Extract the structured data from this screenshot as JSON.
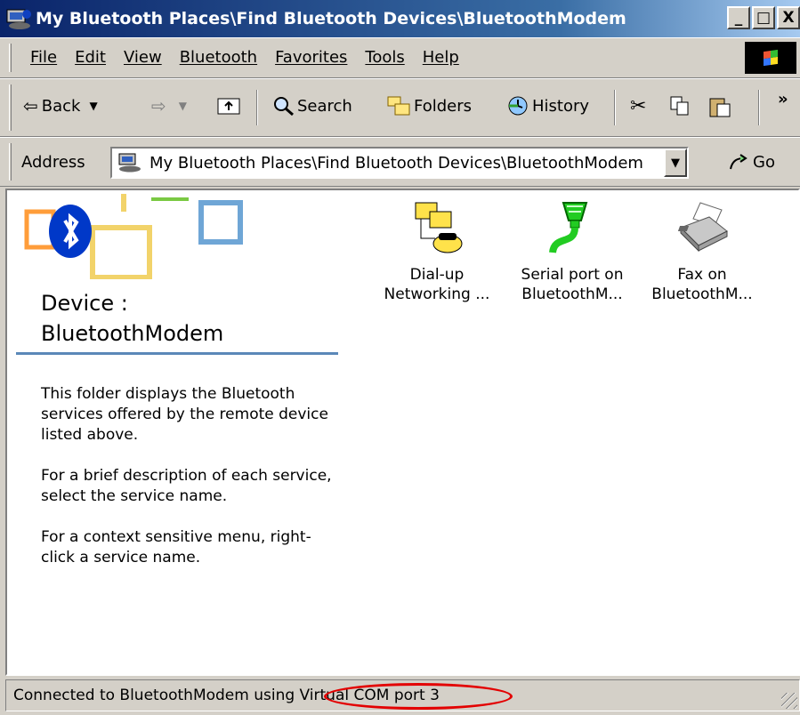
{
  "window": {
    "title": "My Bluetooth Places\\Find Bluetooth Devices\\BluetoothModem",
    "minimize": "_",
    "maximize": "□",
    "close": "X"
  },
  "menu": [
    "File",
    "Edit",
    "View",
    "Bluetooth",
    "Favorites",
    "Tools",
    "Help"
  ],
  "toolbar": {
    "back": "Back",
    "search": "Search",
    "folders": "Folders",
    "history": "History",
    "more": "»"
  },
  "address": {
    "label": "Address",
    "value": "My Bluetooth Places\\Find Bluetooth Devices\\BluetoothModem",
    "go": "Go"
  },
  "panel": {
    "device_title": "Device :",
    "device_name": "BluetoothModem",
    "paragraphs": [
      "This folder displays the Bluetooth services offered by the remote device listed above.",
      "For a brief description of each service, select the service name.",
      "For a context sensitive menu, right-click a service name."
    ]
  },
  "services": [
    {
      "line1": "Dial-up",
      "line2": "Networking ...",
      "icon": "dial-up-networking-icon"
    },
    {
      "line1": "Serial port on",
      "line2": "BluetoothM...",
      "icon": "serial-port-icon"
    },
    {
      "line1": "Fax on",
      "line2": "BluetoothM...",
      "icon": "fax-icon"
    }
  ],
  "status": {
    "text": "Connected to BluetoothModem using Virtual COM port 3"
  },
  "colors": {
    "title_start": "#0a246a",
    "title_end": "#a6caf0",
    "bluetooth_blue": "#0038c8",
    "serial_green": "#22cc22",
    "highlight_red": "#e30000"
  }
}
